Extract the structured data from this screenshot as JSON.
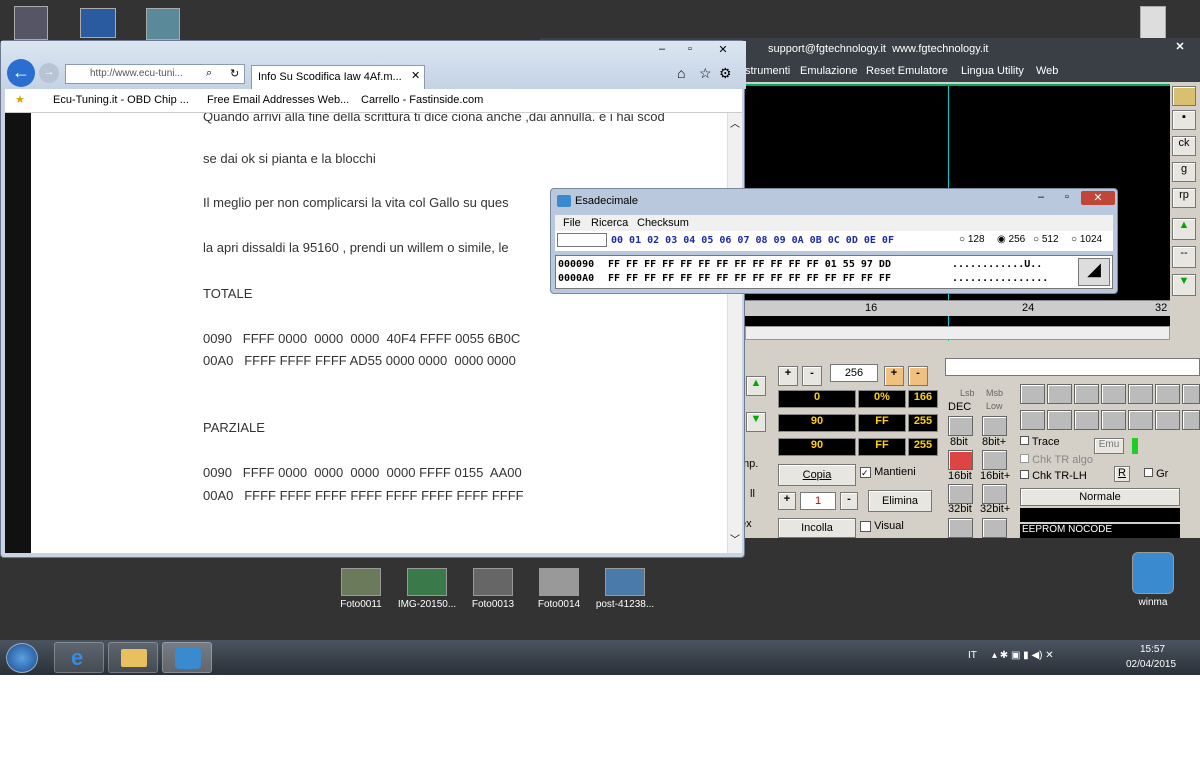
{
  "desktop": {
    "icons": [
      {
        "label": "Foto0011"
      },
      {
        "label": "IMG-20150..."
      },
      {
        "label": "Foto0013"
      },
      {
        "label": "Foto0014"
      },
      {
        "label": "post-41238..."
      }
    ],
    "winma_label": "winma"
  },
  "fgtech": {
    "title_contact": "support@fgtechnology.it  www.fgtechnology.it",
    "menu": [
      "strumenti",
      "Emulazione",
      "Reset Emulatore",
      "Lingua",
      "Utility",
      "Web"
    ],
    "ruler": [
      "16",
      "24",
      "32"
    ],
    "side_buttons": [
      "ck",
      "g",
      "rp",
      "--"
    ],
    "value_256": "256",
    "row1": [
      "0",
      "0%",
      "166"
    ],
    "row2": [
      "90",
      "FF",
      "255"
    ],
    "row3": [
      "90",
      "FF",
      "255"
    ],
    "copia": "Copia",
    "mantieni": "Mantieni",
    "elimina": "Elimina",
    "incolla": "Incolla",
    "visual": "Visual",
    "counter": "1",
    "lsb": "Lsb",
    "msb": "Msb",
    "dec": "DEC",
    "low": "Low",
    "bits": [
      "8bit",
      "8bit+",
      "16bit",
      "16bit+",
      "32bit",
      "32bit+"
    ],
    "trace": "Trace",
    "emu": "Emu",
    "chk_tr_algo": "Chk TR algo",
    "chk_tr_lh": "Chk TR-LH",
    "r": "R",
    "gr": "Gr",
    "normale": "Normale",
    "eeprom": "EEPROM NOCODE",
    "left_labels": [
      "mp.",
      "ll",
      "ex"
    ]
  },
  "browser": {
    "address": "http://www.ecu-tuni...",
    "tab_label": "Info Su Scodifica Iaw 4Af.m...",
    "favorites": [
      "Ecu-Tuning.it - OBD Chip ...",
      "Free Email Addresses Web...",
      "Carrello - Fastinside.com"
    ],
    "lines": [
      "Quando arrivi alla fine della scrittura ti dice ciona anche ,dai annulla. e i hai scod",
      "se dai ok si pianta e la blocchi",
      "Il meglio per non complicarsi la vita col Gallo su ques",
      " la apri dissaldi la 95160 , prendi un willem o simile, le",
      "TOTALE",
      "0090   FFFF 0000  0000  0000  40F4 FFFF 0055 6B0C",
      "00A0   FFFF FFFF FFFF AD55 0000 0000  0000 0000",
      "PARZIALE",
      "0090   FFFF 0000  0000  0000  0000 FFFF 0155  AA00",
      "00A0   FFFF FFFF FFFF FFFF FFFF FFFF FFFF FFFF"
    ]
  },
  "hex_window": {
    "title": "Esadecimale",
    "menu": [
      "File",
      "Ricerca",
      "Checksum"
    ],
    "columns": "00 01 02 03 04 05 06 07 08 09 0A 0B 0C 0D 0E 0F",
    "sizes": [
      "128",
      "256",
      "512",
      "1024"
    ],
    "selected_size": "256",
    "rows": [
      {
        "addr": "000090",
        "bytes": "FF FF FF FF FF FF FF FF FF FF FF FF 01 55 97 DD",
        "ascii": "............U.."
      },
      {
        "addr": "0000A0",
        "bytes": "FF FF FF FF FF FF FF FF FF FF FF FF FF FF FF FF",
        "ascii": "................"
      }
    ]
  },
  "taskbar": {
    "lang": "IT",
    "time": "15:57",
    "date": "02/04/2015"
  },
  "colors": {
    "desktop": "#333333",
    "accent": "#ffd000",
    "hex_bg": "#ffffff"
  }
}
